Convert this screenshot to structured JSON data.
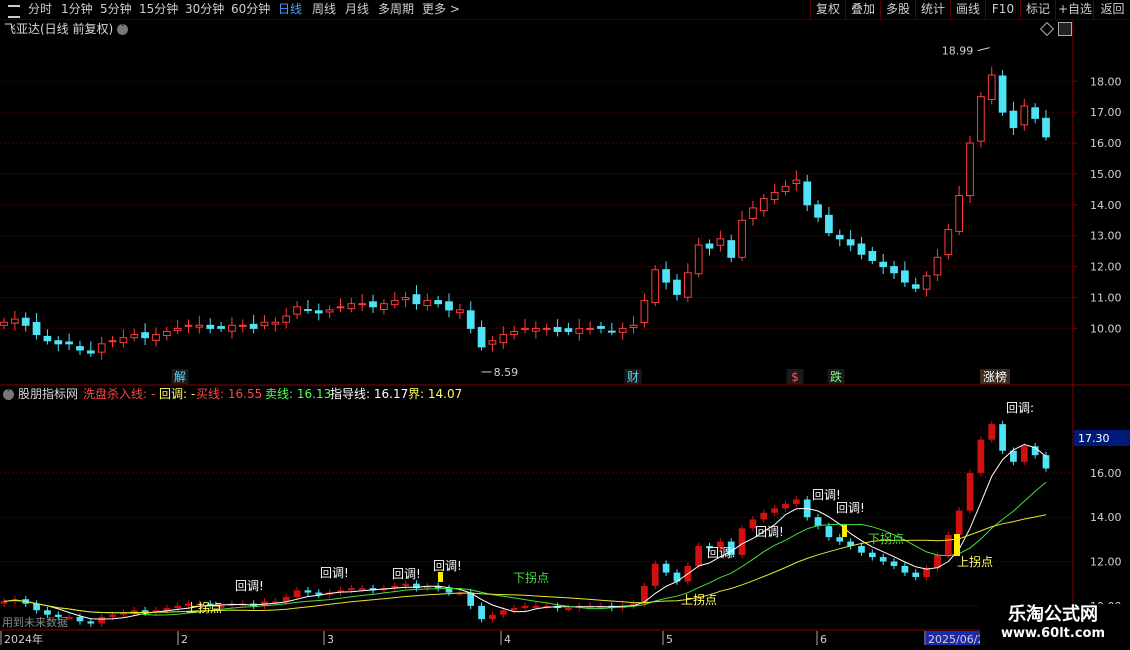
{
  "toolbar": {
    "left": [
      "分时",
      "1分钟",
      "5分钟",
      "15分钟",
      "30分钟",
      "60分钟",
      "日线",
      "周线",
      "月线",
      "多周期",
      "更多 >"
    ],
    "active": "日线",
    "right": [
      "复权",
      "叠加",
      "多股",
      "统计",
      "画线",
      "F10",
      "标记",
      "+自选",
      "返回"
    ]
  },
  "main": {
    "title": "飞亚达(日线 前复权)",
    "price_axis": [
      "18.00",
      "17.00",
      "16.00",
      "15.00",
      "14.00",
      "13.00",
      "12.00",
      "11.00",
      "10.00"
    ],
    "high_label": "18.99",
    "low_label": "8.59",
    "events": [
      {
        "text": "解",
        "color": "#5fd3ff"
      },
      {
        "text": "财",
        "color": "#5fd3ff"
      },
      {
        "text": "$",
        "color": "#ff5050"
      },
      {
        "text": "跌",
        "color": "#7cff7c"
      },
      {
        "text": "涨榜",
        "color": "#ffffff"
      }
    ]
  },
  "indicator": {
    "name": "股朋指标网",
    "legend": [
      {
        "text": "洗盘杀入线: -",
        "color": "#ff4444"
      },
      {
        "text": "回调: -",
        "color": "#ffff66"
      },
      {
        "text": "买线: 16.55",
        "color": "#ff4444"
      },
      {
        "text": "卖线: 16.13",
        "color": "#55ff55"
      },
      {
        "text": "指导线: 16.17",
        "color": "#ffffff"
      },
      {
        "text": "界: 14.07",
        "color": "#ffff66"
      }
    ],
    "axis": [
      "16.00",
      "14.00",
      "12.00",
      "10.00"
    ],
    "current_value": "17.30",
    "callback_label": "回调!",
    "callback_label_top": "回调:",
    "up_turn_label": "上拐点",
    "down_turn_label": "下拐点",
    "note": "用到未来数据"
  },
  "date_axis": {
    "labels": [
      "2024年",
      "2",
      "3",
      "4",
      "5",
      "6",
      "2025/06/2"
    ]
  },
  "watermark": {
    "line1": "乐淘公式网",
    "line2": "www.60lt.com"
  },
  "colors": {
    "up": "#ff3b3b",
    "down": "#4fe3f5",
    "grid": "#4a0000",
    "border": "#8a0000",
    "active_tab": "#4aa0ff"
  },
  "chart_data": {
    "type": "candlestick",
    "y_range": [
      8.2,
      19.4
    ],
    "high": 18.99,
    "low": 8.59,
    "sample_close": [
      10.2,
      10.3,
      10.1,
      9.8,
      9.6,
      9.5,
      9.5,
      9.3,
      9.2,
      9.5,
      9.6,
      9.7,
      9.8,
      9.7,
      9.8,
      9.9,
      10.0,
      10.1,
      10.1,
      10.0,
      10.0,
      10.1,
      10.1,
      10.0,
      10.2,
      10.2,
      10.4,
      10.7,
      10.6,
      10.5,
      10.6,
      10.7,
      10.8,
      10.8,
      10.7,
      10.8,
      10.9,
      11.0,
      10.8,
      10.9,
      10.8,
      10.6,
      10.6,
      10.0,
      9.4,
      9.6,
      9.8,
      9.9,
      10.0,
      10.0,
      10.0,
      9.9,
      9.9,
      10.0,
      10.0,
      10.0,
      9.9,
      10.0,
      10.1,
      10.9,
      11.9,
      11.5,
      11.1,
      11.8,
      12.7,
      12.6,
      12.9,
      12.3,
      13.5,
      13.9,
      14.2,
      14.4,
      14.6,
      14.8,
      14.0,
      13.6,
      13.1,
      12.9,
      12.7,
      12.4,
      12.2,
      12.0,
      11.8,
      11.5,
      11.3,
      11.7,
      12.3,
      13.2,
      14.3,
      16.0,
      17.5,
      18.2,
      17.0,
      16.5,
      17.2,
      16.8,
      16.2
    ]
  }
}
